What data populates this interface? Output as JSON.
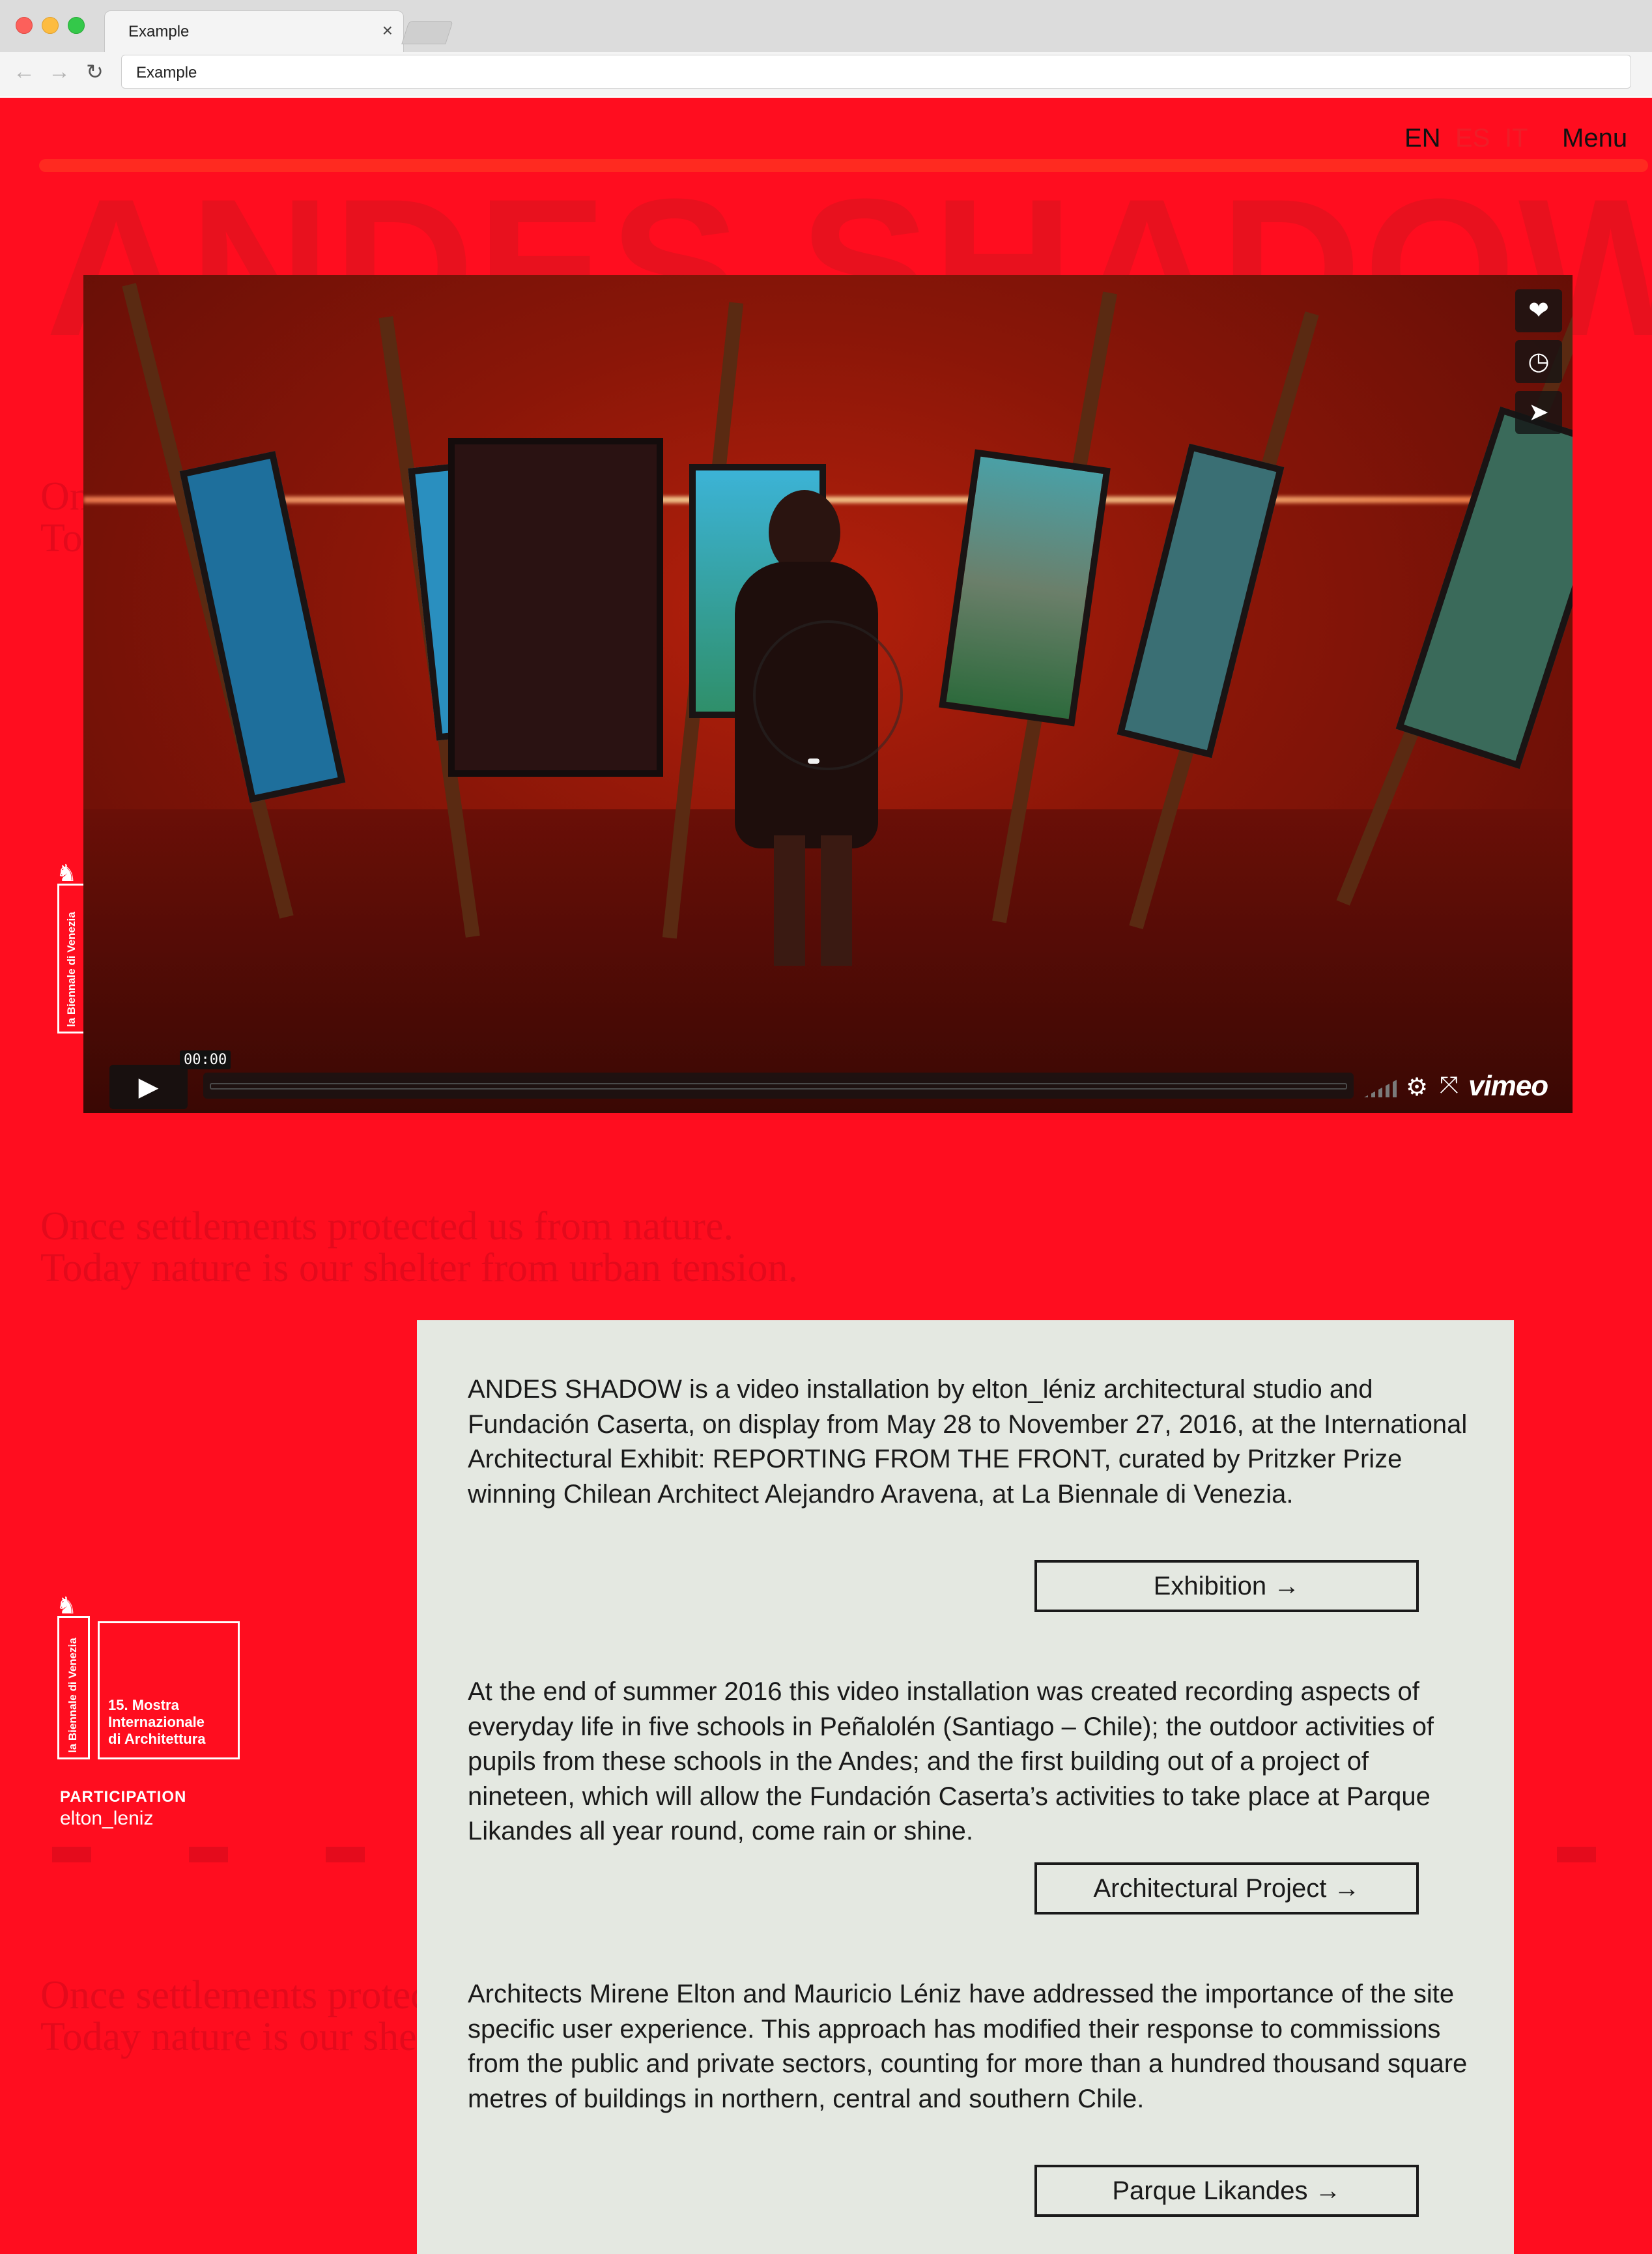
{
  "browser": {
    "tab_title": "Example",
    "tab_close": "×",
    "url": "Example",
    "back_icon": "←",
    "forward_icon": "→",
    "reload_icon": "↻"
  },
  "header": {
    "langs": [
      "EN",
      "ES",
      "IT"
    ],
    "menu_label": "Menu"
  },
  "background": {
    "title": "ANDES SHADOW",
    "quote_line1": "Once settlements protected us from nature.",
    "quote_line2": "Today nature is our shelter from urban tension."
  },
  "biennale": {
    "vertical_text": "la Biennale di Venezia",
    "mostra": "15. Mostra\nInternazionale\ndi Architettura",
    "participation_label": "PARTICIPATION",
    "participant": "elton_leniz"
  },
  "video": {
    "time": "00:00",
    "play_icon": "▶",
    "like_icon": "❤",
    "later_icon": "◷",
    "share_icon": "➤",
    "settings_icon": "⚙",
    "fullscreen_icon": "⤧",
    "brand": "vimeo"
  },
  "card": {
    "para1": "ANDES SHADOW is a video installation by elton_léniz architectural studio and Fundación Caserta, on display from May 28 to November 27, 2016, at the International Architectural Exhibit: REPORTING FROM THE FRONT, curated by Pritzker Prize winning Chilean Architect Alejandro Aravena, at La Biennale di Venezia.",
    "btn1": "Exhibition →",
    "para2": "At the end of summer 2016 this video installation was created recording aspects of everyday life in five schools in Peñalolén (Santiago – Chile); the outdoor activities of pupils from these schools in the Andes; and the first building out of a project of nineteen, which will allow the Fundación Caserta’s activities to take place at Parque Likandes all year round, come rain or shine.",
    "btn2": "Architectural Project →",
    "para3": "Architects Mirene Elton and Mauricio Léniz have addressed the importance of the site specific user experience. This approach has modified their response to commissions from the public and private sectors, counting for more than a hundred thousand square metres of buildings in northern, central and southern Chile.",
    "btn3": "Parque Likandes →"
  },
  "colors": {
    "page_bg": "#ff0d1f",
    "card_bg": "#e4e8e1",
    "text": "#1a1a1a"
  }
}
